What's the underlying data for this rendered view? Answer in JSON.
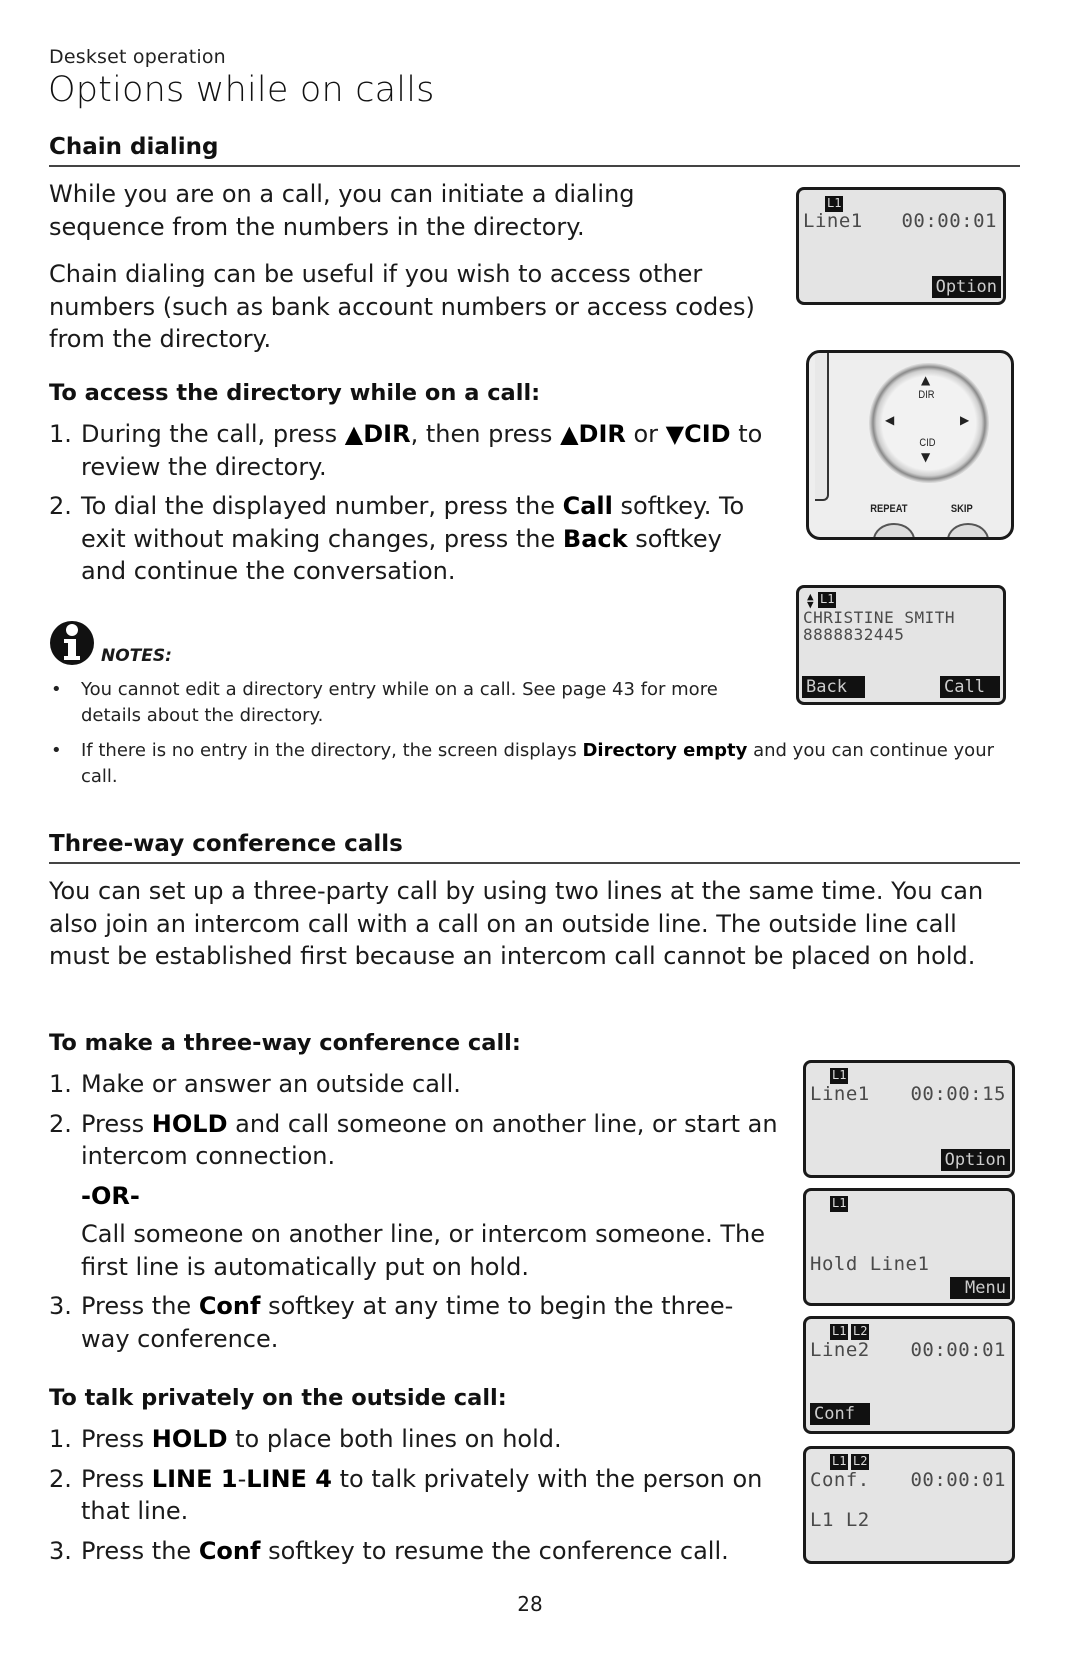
{
  "header": {
    "section": "Deskset operation",
    "title": "Options while on calls"
  },
  "chain_dialing": {
    "heading": "Chain dialing",
    "para1_lines": [
      "While you are on a call, you can initiate a dialing",
      "sequence from the numbers in the directory."
    ],
    "para2_lines": [
      "Chain dialing can be useful if you wish to access other",
      "numbers (such as bank account numbers or access codes)",
      "from the directory."
    ],
    "subheading": "To access the directory while on a call:",
    "steps": [
      {
        "num": "1.",
        "parts": [
          "During the call, press ",
          "▲DIR",
          ", then press ",
          "▲DIR",
          " or ",
          "▼CID",
          " to review the directory."
        ]
      },
      {
        "num": "2.",
        "parts": [
          "To dial the displayed number, press the ",
          "Call",
          " softkey. To exit without making changes, press the ",
          "Back",
          " softkey and continue the conversation."
        ]
      }
    ],
    "notes_label": "NOTES:",
    "notes": [
      {
        "parts": [
          "You cannot edit a directory entry while on a call. See page 43 for more details about the directory."
        ]
      },
      {
        "parts": [
          "If there is no entry in the directory, the screen displays ",
          "Directory empty",
          " and you can continue your call."
        ]
      }
    ]
  },
  "three_way": {
    "heading": "Three-way conference calls",
    "para": "You can set up a three-party call by using two lines at the same time. You can also join an intercom call with a call on an outside line. The outside line call must be established first because an intercom call cannot be placed on hold.",
    "make_heading": "To make a three-way conference call:",
    "make_steps": [
      {
        "num": "1.",
        "parts": [
          "Make or answer an outside call."
        ]
      },
      {
        "num": "2.",
        "parts": [
          "Press ",
          "HOLD",
          " and call someone on another line, or start an intercom connection."
        ]
      }
    ],
    "or_label": "-OR-",
    "or_text": "Call someone on another line, or intercom someone. The first line is automatically put on hold.",
    "make_step3": {
      "num": "3.",
      "parts": [
        "Press the ",
        "Conf",
        " softkey at any time to begin the three-way conference."
      ]
    },
    "private_heading": "To talk privately on the outside call:",
    "private_steps": [
      {
        "num": "1.",
        "parts": [
          "Press ",
          "HOLD",
          " to place both lines on hold."
        ]
      },
      {
        "num": "2.",
        "parts": [
          "Press ",
          "LINE 1",
          "-",
          "LINE 4",
          " to talk privately with the person on that line."
        ]
      },
      {
        "num": "3.",
        "parts": [
          "Press the ",
          "Conf",
          " softkey to resume the conference call."
        ]
      }
    ]
  },
  "screens": {
    "call_line1": {
      "tag": "L1",
      "line": "Line1",
      "timer": "00:00:01",
      "softkey_right": "Option"
    },
    "keypad": {
      "up_label": "DIR",
      "down_label": "CID",
      "btn_left": "REPEAT",
      "btn_right": "SKIP"
    },
    "directory": {
      "tag": "L1",
      "name": "CHRISTINE SMITH",
      "number": "8888832445",
      "softkey_left": "Back",
      "softkey_right": "Call"
    },
    "call_line1_b": {
      "tag": "L1",
      "line": "Line1",
      "timer": "00:00:15",
      "softkey_right": "Option"
    },
    "hold": {
      "tag": "L1",
      "text": "Hold Line1",
      "softkey_right": "Menu"
    },
    "line2": {
      "tags": [
        "L1",
        "L2"
      ],
      "line": "Line2",
      "timer": "00:00:01",
      "softkey_left": "Conf"
    },
    "conf": {
      "tags": [
        "L1",
        "L2"
      ],
      "line": "Conf.",
      "timer": "00:00:01",
      "lines": "L1 L2"
    }
  },
  "footer": {
    "page_number": "28"
  }
}
